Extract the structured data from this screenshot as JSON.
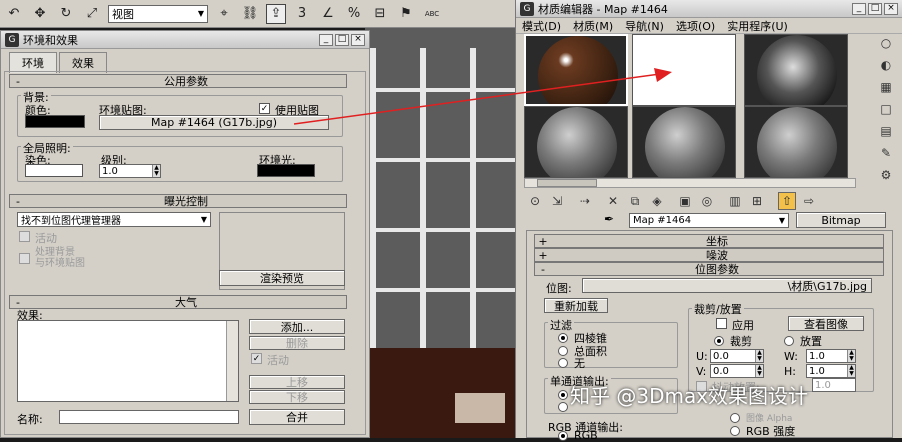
{
  "toolbar": {
    "view_dropdown": "视图",
    "snap_num_a": "3",
    "snap_num_b": "%",
    "abc_label": "ABC"
  },
  "env_window": {
    "title": "环境和效果",
    "tabs": [
      "环境",
      "效果"
    ],
    "common_params": {
      "rollout_title": "公用参数",
      "background_group": "背景:",
      "color_label": "颜色:",
      "env_map_label": "环境贴图:",
      "use_map_label": "使用贴图",
      "use_map_checked": true,
      "map_button": "Map #1464 (G17b.jpg)",
      "global_light_group": "全局照明:",
      "tint_label": "染色:",
      "level_label": "级别:",
      "level_value": "1.0",
      "ambient_label": "环境光:"
    },
    "exposure": {
      "rollout_title": "曝光控制",
      "dropdown": "找不到位图代理管理器",
      "active_label": "活动",
      "process_bg_label_1": "处理背景",
      "process_bg_label_2": "与环境贴图",
      "render_preview_button": "渲染预览"
    },
    "atmosphere": {
      "rollout_title": "大气",
      "effects_label": "效果:",
      "add_button": "添加...",
      "delete_button": "删除",
      "active_label": "活动",
      "move_up_button": "上移",
      "move_down_button": "下移",
      "name_label": "名称:",
      "merge_button": "合并"
    }
  },
  "mat_editor": {
    "title": "材质编辑器 - Map #1464",
    "menu": [
      "模式(D)",
      "材质(M)",
      "导航(N)",
      "选项(O)",
      "实用程序(U)"
    ],
    "map_name_dropdown": "Map #1464",
    "map_type_button": "Bitmap",
    "rollouts": {
      "coords": "坐标",
      "noise": "噪波",
      "bitmap_params": "位图参数"
    },
    "bitmap_label": "位图:",
    "bitmap_path": "\\材质\\G17b.jpg",
    "reload_button": "重新加载",
    "crop_group": "裁剪/放置",
    "apply_label": "应用",
    "view_image_button": "查看图像",
    "crop_label": "裁剪",
    "place_label": "放置",
    "u_label": "U:",
    "u_value": "0.0",
    "w_label": "W:",
    "w_value": "1.0",
    "v_label": "V:",
    "v_value": "0.0",
    "h_label": "H:",
    "h_value": "1.0",
    "jitter_label": "抖动放置:",
    "jitter_value": "1.0",
    "filter_group": "过滤",
    "filter_options": [
      "四棱锥",
      "总面积",
      "无"
    ],
    "mono_group": "单通道输出:",
    "alpha_source_label": "图像 Alpha",
    "rgb_intensity_label": "RGB 强度",
    "rgb_group": "RGB 通道输出:",
    "rgb_option": "RGB"
  },
  "watermark": "知乎 @3Dmax效果图设计",
  "colors": {
    "panel_bg": "#d4d0c8",
    "arrow_red": "#e02020",
    "swatch_black": "#000000",
    "swatch_white": "#ffffff"
  }
}
